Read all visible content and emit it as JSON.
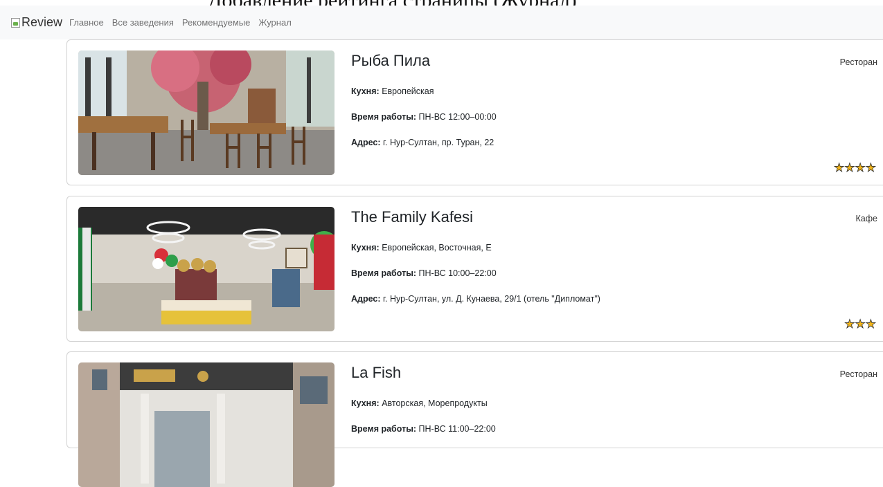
{
  "header_fragment": "Добавление рейтинга страницы (Журнал)",
  "navbar": {
    "brand_alt": "Review",
    "links": [
      "Главное",
      "Все заведения",
      "Рекомендуемые",
      "Журнал"
    ]
  },
  "labels": {
    "cuisine": "Кухня:",
    "hours": "Время работы:",
    "address": "Адрес:"
  },
  "restaurants": [
    {
      "name": "Рыба Пила",
      "type": "Ресторан",
      "cuisine": "Европейская",
      "hours": "ПН-ВС 12:00–00:00",
      "address": "г. Нур-Султан, пр. Туран, 22",
      "rating": 4
    },
    {
      "name": "The Family Kafesi",
      "type": "Кафе",
      "cuisine": "Европейская, Восточная, Е",
      "hours": "ПН-ВС 10:00–22:00",
      "address": "г. Нур-Султан, ул. Д. Кунаева, 29/1 (отель \"Дипломат\")",
      "rating": 3
    },
    {
      "name": "La Fish",
      "type": "Ресторан",
      "cuisine": "Авторская, Морепродукты",
      "hours": "ПН-ВС 11:00–22:00"
    }
  ],
  "star_color": "#f2b418"
}
